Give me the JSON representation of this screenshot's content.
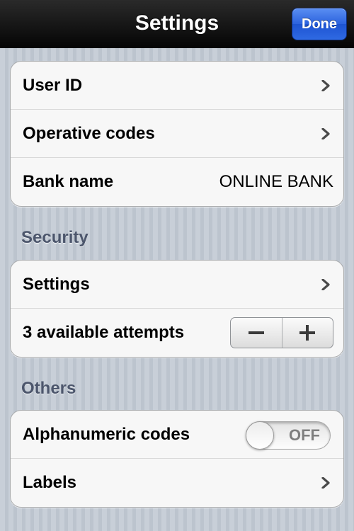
{
  "navbar": {
    "title": "Settings",
    "done_label": "Done"
  },
  "account": {
    "user_id_label": "User ID",
    "operative_codes_label": "Operative codes",
    "bank_name_label": "Bank name",
    "bank_name_value": "ONLINE BANK"
  },
  "security": {
    "header": "Security",
    "settings_label": "Settings",
    "attempts_label": "3 available attempts"
  },
  "others": {
    "header": "Others",
    "alphanumeric_label": "Alphanumeric codes",
    "alphanumeric_toggle": "OFF",
    "labels_label": "Labels"
  },
  "icons": {
    "chevron": "chevron-right-icon",
    "minus": "minus-icon",
    "plus": "plus-icon"
  },
  "colors": {
    "done_button": "#2b62de",
    "section_header": "#4c566c"
  }
}
